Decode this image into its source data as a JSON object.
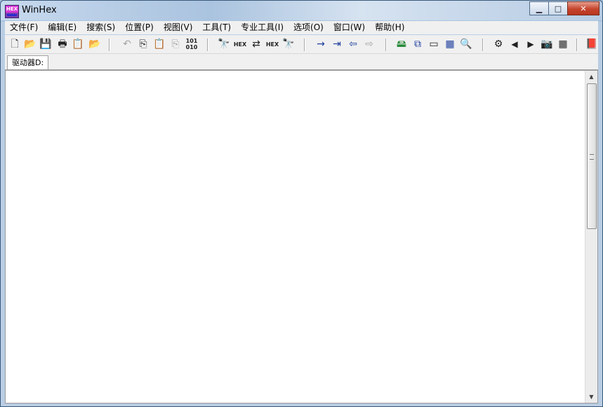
{
  "window": {
    "title": "WinHex",
    "app_icon_text": "HEX"
  },
  "window_controls": {
    "minimize": "▁",
    "maximize": "□",
    "close": "✕"
  },
  "menu": [
    {
      "label": "文件(F)"
    },
    {
      "label": "编辑(E)"
    },
    {
      "label": "搜索(S)"
    },
    {
      "label": "位置(P)"
    },
    {
      "label": "视图(V)"
    },
    {
      "label": "工具(T)"
    },
    {
      "label": "专业工具(I)"
    },
    {
      "label": "选项(O)"
    },
    {
      "label": "窗口(W)"
    },
    {
      "label": "帮助(H)"
    }
  ],
  "toolbar": {
    "new": {
      "icon": "new-file-icon",
      "glyph": "🗋"
    },
    "open": {
      "icon": "open-folder-icon",
      "glyph": "📂"
    },
    "save": {
      "icon": "save-icon",
      "glyph": "💾"
    },
    "print": {
      "icon": "print-icon",
      "glyph": "🖶"
    },
    "properties": {
      "icon": "properties-icon",
      "glyph": "📋"
    },
    "open_folder2": {
      "icon": "open-folder-2-icon",
      "glyph": "📂"
    },
    "undo": {
      "icon": "undo-icon",
      "glyph": "↶"
    },
    "copy": {
      "icon": "copy-icon",
      "glyph": "⎘"
    },
    "paste": {
      "icon": "paste-icon",
      "glyph": "📋"
    },
    "paste_into": {
      "icon": "paste-into-icon",
      "glyph": "⎘"
    },
    "binary": {
      "icon": "binary-icon",
      "glyph": "101\n010"
    },
    "find_text": {
      "icon": "binoculars-icon",
      "glyph": "🔭"
    },
    "find_hex": {
      "icon": "find-hex-icon",
      "glyph": "HEX"
    },
    "replace_text": {
      "icon": "replace-icon",
      "glyph": "⇄"
    },
    "replace_hex": {
      "icon": "replace-hex-icon",
      "glyph": "HEX"
    },
    "find_again": {
      "icon": "binoculars-blue-icon",
      "glyph": "🔭"
    },
    "goto_offset": {
      "icon": "goto-arrow-icon",
      "glyph": "→"
    },
    "goto_sector": {
      "icon": "goto-sector-icon",
      "glyph": "⇥"
    },
    "back": {
      "icon": "back-arrow-icon",
      "glyph": "⇦"
    },
    "forward": {
      "icon": "forward-arrow-icon",
      "glyph": "⇨"
    },
    "open_disk": {
      "icon": "disk-icon",
      "glyph": "🖴"
    },
    "clone_disk": {
      "icon": "clone-icon",
      "glyph": "⧉"
    },
    "ram": {
      "icon": "ram-icon",
      "glyph": "▭"
    },
    "calculator": {
      "icon": "calculator-icon",
      "glyph": "▦"
    },
    "search": {
      "icon": "magnifier-icon",
      "glyph": "🔍"
    },
    "access": {
      "icon": "access-icon",
      "glyph": "⚙"
    },
    "prev": {
      "icon": "triangle-left-icon",
      "glyph": "◀"
    },
    "next": {
      "icon": "triangle-right-icon",
      "glyph": "▶"
    },
    "snapshot": {
      "icon": "camera-icon",
      "glyph": "📷"
    },
    "table": {
      "icon": "grid-icon",
      "glyph": "▦"
    },
    "help": {
      "icon": "book-icon",
      "glyph": "📕"
    }
  },
  "tabs": [
    {
      "label": "驱动器D:"
    }
  ]
}
